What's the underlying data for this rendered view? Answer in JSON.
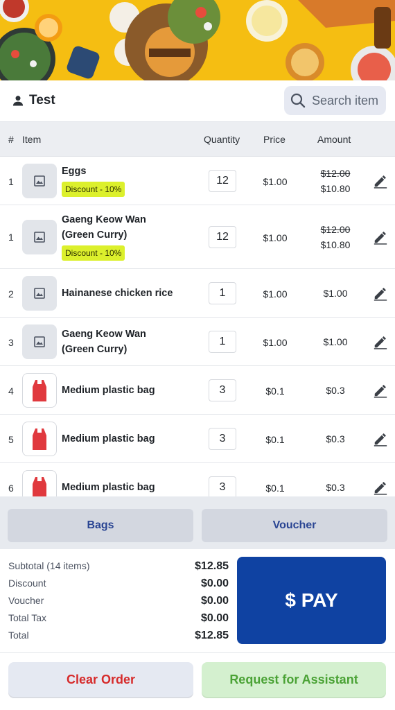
{
  "header": {
    "user_name": "Test",
    "search_placeholder": "Search item"
  },
  "table": {
    "columns": {
      "index": "#",
      "item": "Item",
      "quantity": "Quantity",
      "price": "Price",
      "amount": "Amount"
    },
    "rows": [
      {
        "index": "1",
        "name": "Eggs",
        "discount": "Discount - 10%",
        "quantity": "12",
        "price": "$1.00",
        "original_amount": "$12.00",
        "amount": "$10.80",
        "thumb": "image-placeholder-icon"
      },
      {
        "index": "1",
        "name": "Gaeng Keow Wan (Green Curry)",
        "discount": "Discount - 10%",
        "quantity": "12",
        "price": "$1.00",
        "original_amount": "$12.00",
        "amount": "$10.80",
        "thumb": "image-placeholder-icon"
      },
      {
        "index": "2",
        "name": "Hainanese chicken rice",
        "discount": "",
        "quantity": "1",
        "price": "$1.00",
        "original_amount": "",
        "amount": "$1.00",
        "thumb": "image-placeholder-icon"
      },
      {
        "index": "3",
        "name": "Gaeng Keow Wan (Green Curry)",
        "discount": "",
        "quantity": "1",
        "price": "$1.00",
        "original_amount": "",
        "amount": "$1.00",
        "thumb": "image-placeholder-icon"
      },
      {
        "index": "4",
        "name": "Medium plastic bag",
        "discount": "",
        "quantity": "3",
        "price": "$0.1",
        "original_amount": "",
        "amount": "$0.3",
        "thumb": "plastic-bag-icon"
      },
      {
        "index": "5",
        "name": "Medium plastic bag",
        "discount": "",
        "quantity": "3",
        "price": "$0.1",
        "original_amount": "",
        "amount": "$0.3",
        "thumb": "plastic-bag-icon"
      },
      {
        "index": "6",
        "name": "Medium plastic bag",
        "discount": "",
        "quantity": "3",
        "price": "$0.1",
        "original_amount": "",
        "amount": "$0.3",
        "thumb": "plastic-bag-icon"
      }
    ]
  },
  "actions": {
    "bags": "Bags",
    "voucher": "Voucher"
  },
  "summary": {
    "subtotal_label": "Subtotal (14 items)",
    "subtotal": "$12.85",
    "discount_label": "Discount",
    "discount": "$0.00",
    "voucher_label": "Voucher",
    "voucher": "$0.00",
    "tax_label": "Total Tax",
    "tax": "$0.00",
    "total_label": "Total",
    "total": "$12.85"
  },
  "pay_label": "$ PAY",
  "bottom": {
    "clear": "Clear Order",
    "assist": "Request for Assistant"
  },
  "colors": {
    "pay": "#0f42a2",
    "discount_badge": "#dcf02c",
    "clear_text": "#d62a2a",
    "assist_text": "#4aa235",
    "banner": "#f6c21a"
  }
}
